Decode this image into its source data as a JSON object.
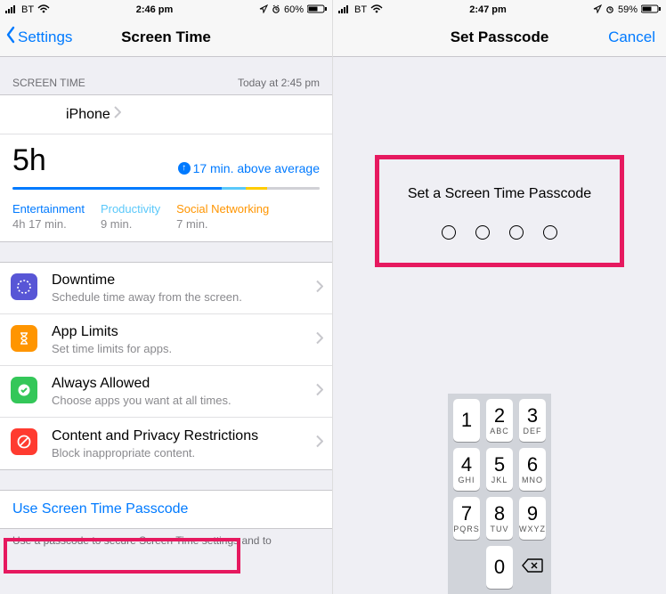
{
  "left": {
    "status": {
      "carrier": "BT",
      "time": "2:46 pm",
      "battery": "60%"
    },
    "nav": {
      "back": "Settings",
      "title": "Screen Time"
    },
    "section_header": {
      "left": "SCREEN TIME",
      "right": "Today at 2:45 pm"
    },
    "device": "iPhone",
    "total": "5h",
    "delta": "17 min. above average",
    "categories": [
      {
        "label": "Entertainment",
        "value": "4h 17 min."
      },
      {
        "label": "Productivity",
        "value": "9 min."
      },
      {
        "label": "Social Networking",
        "value": "7 min."
      }
    ],
    "features": [
      {
        "title": "Downtime",
        "sub": "Schedule time away from the screen."
      },
      {
        "title": "App Limits",
        "sub": "Set time limits for apps."
      },
      {
        "title": "Always Allowed",
        "sub": "Choose apps you want at all times."
      },
      {
        "title": "Content and Privacy Restrictions",
        "sub": "Block inappropriate content."
      }
    ],
    "passcode_link": "Use Screen Time Passcode",
    "footer": "Use a passcode to secure Screen Time settings and to"
  },
  "right": {
    "status": {
      "carrier": "BT",
      "time": "2:47 pm",
      "battery": "59%"
    },
    "nav": {
      "title": "Set Passcode",
      "cancel": "Cancel"
    },
    "prompt": "Set a Screen Time Passcode",
    "keypad": [
      {
        "n": "1",
        "l": ""
      },
      {
        "n": "2",
        "l": "ABC"
      },
      {
        "n": "3",
        "l": "DEF"
      },
      {
        "n": "4",
        "l": "GHI"
      },
      {
        "n": "5",
        "l": "JKL"
      },
      {
        "n": "6",
        "l": "MNO"
      },
      {
        "n": "7",
        "l": "PQRS"
      },
      {
        "n": "8",
        "l": "TUV"
      },
      {
        "n": "9",
        "l": "WXYZ"
      },
      {
        "n": "",
        "l": ""
      },
      {
        "n": "0",
        "l": ""
      },
      {
        "n": "⌫",
        "l": ""
      }
    ]
  }
}
